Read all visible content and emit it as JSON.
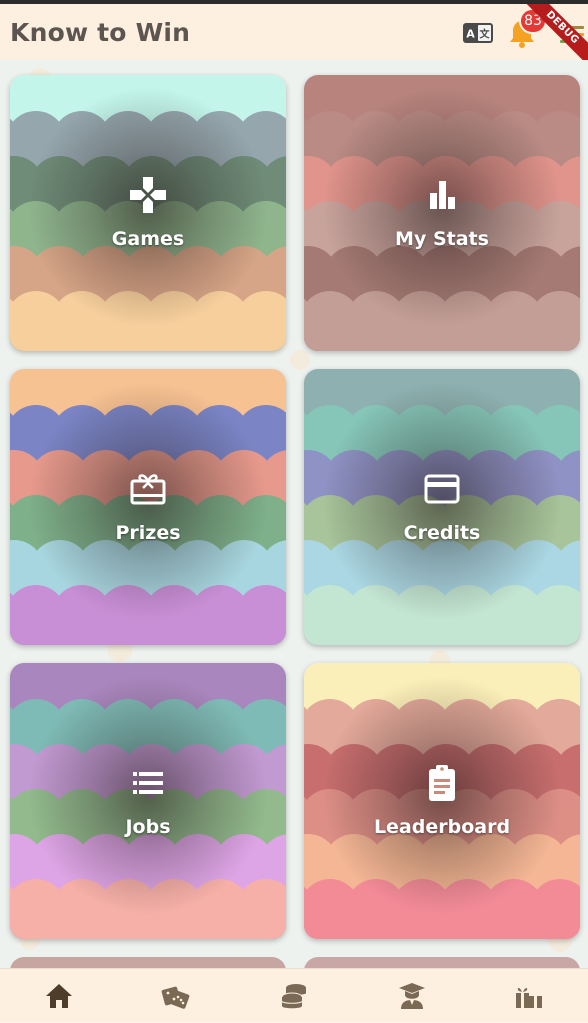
{
  "app": {
    "title": "Know to Win"
  },
  "header": {
    "notification_count": "83",
    "debug_label": "DEBUG"
  },
  "tiles": [
    {
      "label": "Games",
      "icon": "gamepad-icon",
      "colors": [
        "#c3f5ea",
        "#95a6ad",
        "#6f8c78",
        "#8fb58d",
        "#d6a486",
        "#f6cf9c"
      ]
    },
    {
      "label": "My Stats",
      "icon": "bar-chart-icon",
      "colors": [
        "#b7837c",
        "#b98b84",
        "#e0948c",
        "#c8a39c",
        "#a57a74",
        "#c39e96"
      ]
    },
    {
      "label": "Prizes",
      "icon": "gift-card-icon",
      "colors": [
        "#f7c292",
        "#7b85c6",
        "#e79a8c",
        "#7eb08a",
        "#a8d6e0",
        "#c98fd6"
      ]
    },
    {
      "label": "Credits",
      "icon": "credit-card-icon",
      "colors": [
        "#8eb0b0",
        "#86c6b8",
        "#8f92c4",
        "#a7c49a",
        "#aad7e3",
        "#c3e6d2"
      ]
    },
    {
      "label": "Jobs",
      "icon": "list-icon",
      "colors": [
        "#a986bd",
        "#7fbbb6",
        "#c29ad2",
        "#92ba8d",
        "#dea5e6",
        "#f6b0a8"
      ]
    },
    {
      "label": "Leaderboard",
      "icon": "clipboard-icon",
      "colors": [
        "#fbefb9",
        "#e3a99a",
        "#c86e6e",
        "#dd8f86",
        "#f4b694",
        "#f38b97"
      ]
    }
  ],
  "bottom_nav": [
    {
      "name": "home",
      "icon": "home-icon",
      "active": true
    },
    {
      "name": "games",
      "icon": "dice-icon",
      "active": false
    },
    {
      "name": "coins",
      "icon": "coins-icon",
      "active": false
    },
    {
      "name": "jobs",
      "icon": "graduate-icon",
      "active": false
    },
    {
      "name": "prizes",
      "icon": "gifts-icon",
      "active": false
    }
  ],
  "colors": {
    "appbar_bg": "#fdf0e1",
    "title_text": "#5d5650",
    "nav_icon": "#7a6a55",
    "nav_active": "#4e3d2a",
    "badge": "#e53935"
  }
}
